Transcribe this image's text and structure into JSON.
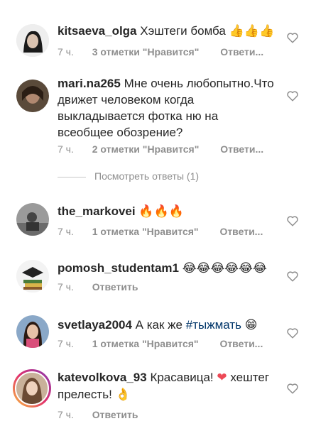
{
  "comments": [
    {
      "username": "kitsaeva_olga",
      "text": "Хэштеги бомба",
      "emoji": "👍👍👍",
      "time": "7 ч.",
      "likes": "3 отметки \"Нравится\"",
      "reply": "Ответи..."
    },
    {
      "username": "mari.na265",
      "text": "Мне очень любопытно.Что движет человеком когда выкладывается фотка ню на всеобщее обозрение?",
      "time": "7 ч.",
      "likes": "2 отметки \"Нравится\"",
      "reply": "Ответи..."
    },
    {
      "username": "the_markovei",
      "emoji": "🔥🔥🔥",
      "time": "7 ч.",
      "likes": "1 отметка \"Нравится\"",
      "reply": "Ответи..."
    },
    {
      "username": "pomosh_studentam1",
      "emoji": "😂😂😂😂😂😂",
      "time": "7 ч.",
      "reply": "Ответить"
    },
    {
      "username": "svetlaya2004",
      "text": "А как же",
      "hashtag": "#тыжмать",
      "emoji": "😁",
      "time": "7 ч.",
      "likes": "1 отметка \"Нравится\"",
      "reply": "Ответи..."
    },
    {
      "username": "katevolkova_93",
      "text": "Красавица!",
      "emoji_heart": "❤",
      "text2": "хештег прелесть!",
      "emoji": "👌",
      "time": "7 ч.",
      "reply": "Ответить"
    }
  ],
  "view_replies": "Посмотреть ответы (1)",
  "colors": {
    "meta": "#8e8e8e",
    "hashtag": "#003569",
    "heart_emoji": "#ed4956"
  }
}
